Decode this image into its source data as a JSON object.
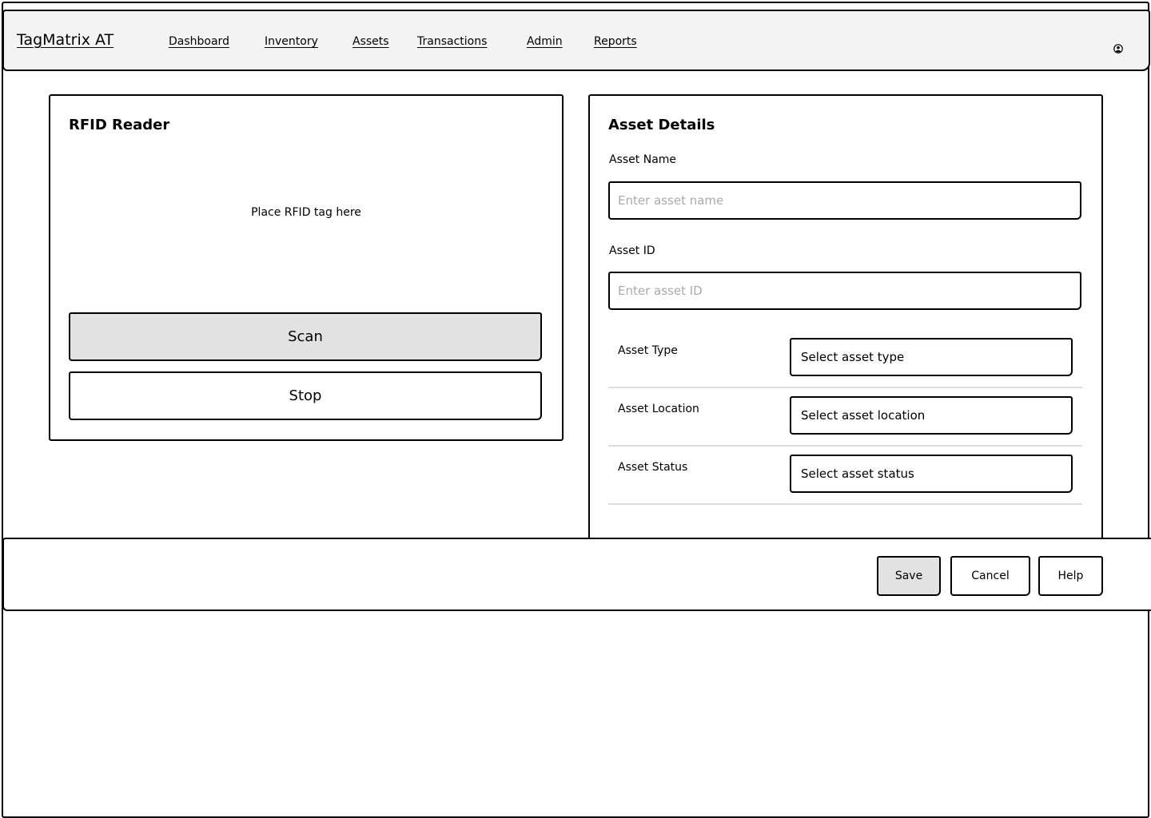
{
  "header": {
    "brand": "TagMatrix AT",
    "nav": [
      {
        "label": "Dashboard"
      },
      {
        "label": "Inventory"
      },
      {
        "label": "Assets"
      },
      {
        "label": "Transactions"
      },
      {
        "label": "Admin"
      },
      {
        "label": "Reports"
      }
    ],
    "user_icon": "user-circle-icon"
  },
  "rfid_panel": {
    "title": "RFID Reader",
    "hint": "Place RFID tag here",
    "scan_label": "Scan",
    "stop_label": "Stop"
  },
  "asset_panel": {
    "title": "Asset Details",
    "name_label": "Asset Name",
    "name_placeholder": "Enter asset name",
    "id_label": "Asset ID",
    "id_placeholder": "Enter asset ID",
    "rows": [
      {
        "label": "Asset Type",
        "value": "Select asset type"
      },
      {
        "label": "Asset Location",
        "value": "Select asset location"
      },
      {
        "label": "Asset Status",
        "value": "Select asset status"
      }
    ]
  },
  "footer": {
    "save_label": "Save",
    "cancel_label": "Cancel",
    "help_label": "Help"
  },
  "colors": {
    "header_bg": "#f3f3f3",
    "primary_button_bg": "#e2e2e2",
    "placeholder": "#aaaaaa",
    "divider": "#dddddd"
  }
}
